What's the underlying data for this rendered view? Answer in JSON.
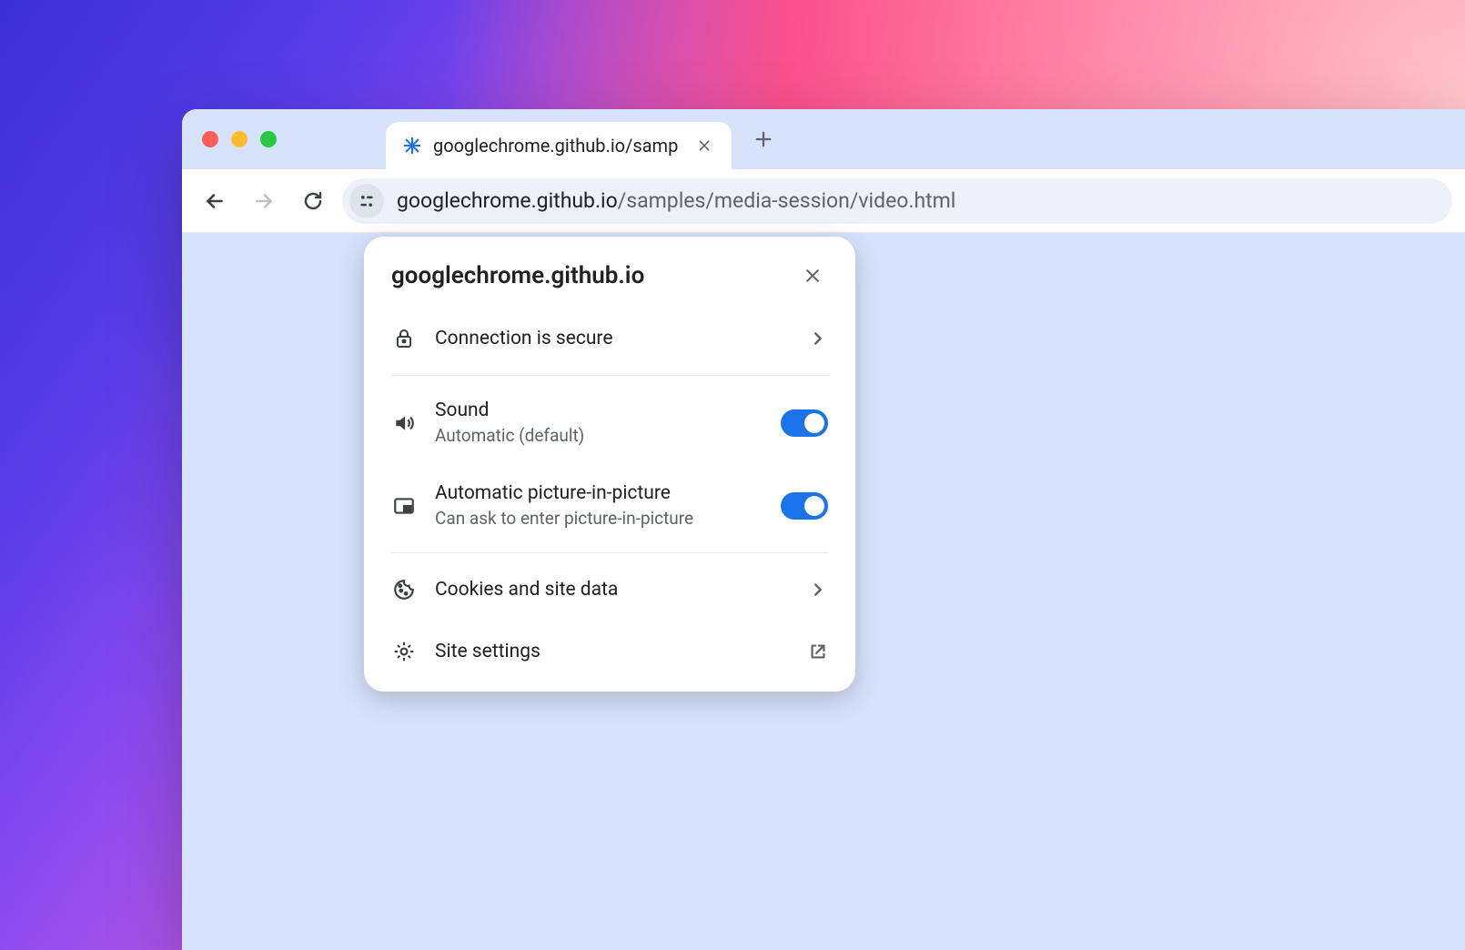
{
  "tab": {
    "title": "googlechrome.github.io/samp"
  },
  "url": {
    "host": "googlechrome.github.io",
    "path": "/samples/media-session/video.html"
  },
  "popover": {
    "title": "googlechrome.github.io",
    "connection_label": "Connection is secure",
    "sound": {
      "title": "Sound",
      "subtitle": "Automatic (default)",
      "on": true
    },
    "pip": {
      "title": "Automatic picture-in-picture",
      "subtitle": "Can ask to enter picture-in-picture",
      "on": true
    },
    "cookies_label": "Cookies and site data",
    "settings_label": "Site settings"
  }
}
